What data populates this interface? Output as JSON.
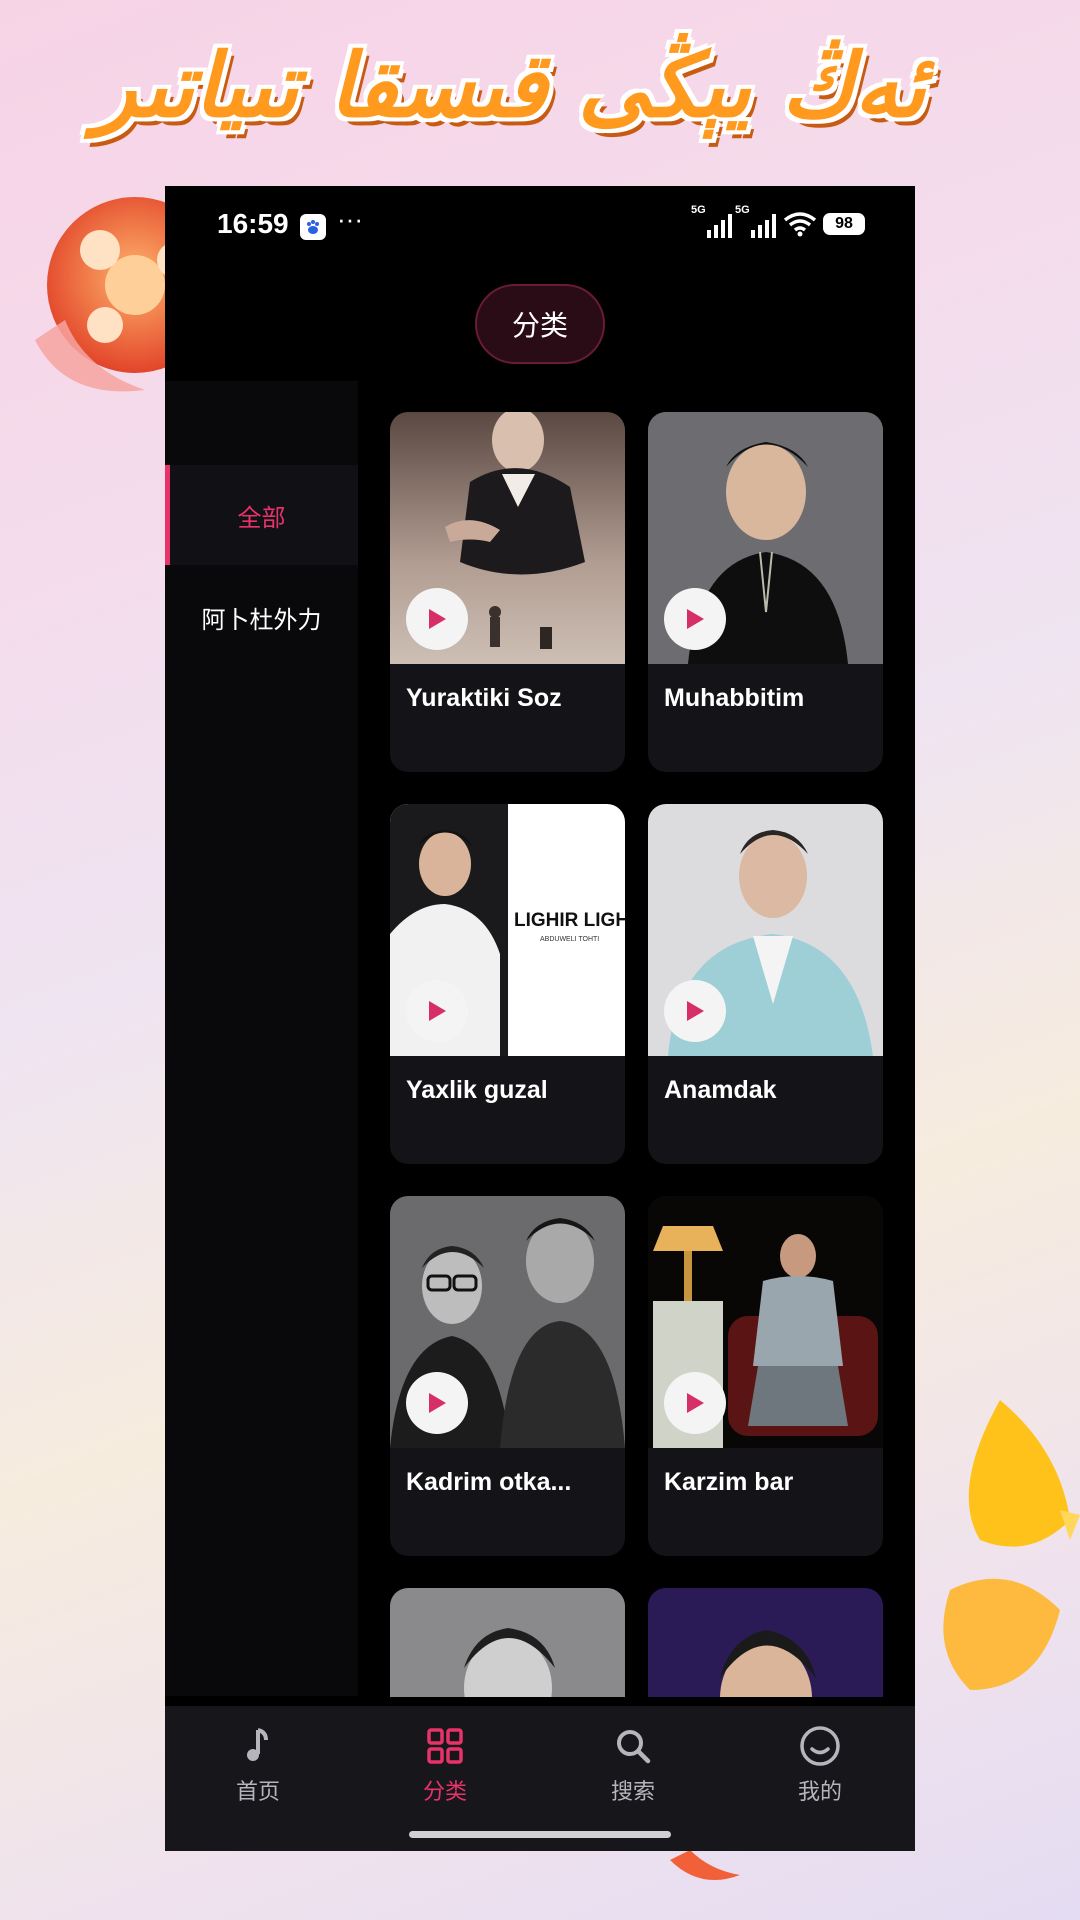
{
  "banner": {
    "text": "ئەڭ يېڭى قىسقا تىياتىر"
  },
  "status_bar": {
    "time": "16:59",
    "more": "···",
    "network_1": "5G",
    "network_2": "5G",
    "battery": "98"
  },
  "header": {
    "category_pill": "分类"
  },
  "sidebar": {
    "items": [
      {
        "label": "全部",
        "active": true
      },
      {
        "label": "阿卜杜外力",
        "active": false
      }
    ]
  },
  "grid": {
    "cards": [
      {
        "title": "Yuraktiki Soz"
      },
      {
        "title": "Muhabbitim"
      },
      {
        "title": "Yaxlik guzal",
        "poster_text": "LIGHIR LIGHIR",
        "poster_subtext": "ABDUWELI TOHTI"
      },
      {
        "title": "Anamdak"
      },
      {
        "title": "Kadrim otka..."
      },
      {
        "title": "Karzim bar"
      },
      {
        "title": ""
      },
      {
        "title": ""
      }
    ]
  },
  "tabbar": {
    "tabs": [
      {
        "label": "首页",
        "icon": "music-note-icon",
        "active": false
      },
      {
        "label": "分类",
        "icon": "grid-icon",
        "active": true
      },
      {
        "label": "搜索",
        "icon": "search-icon",
        "active": false
      },
      {
        "label": "我的",
        "icon": "smile-icon",
        "active": false
      }
    ]
  },
  "colors": {
    "accent": "#e8336a",
    "background": "#000000",
    "card": "#141418",
    "banner": "#ff9a1f"
  }
}
